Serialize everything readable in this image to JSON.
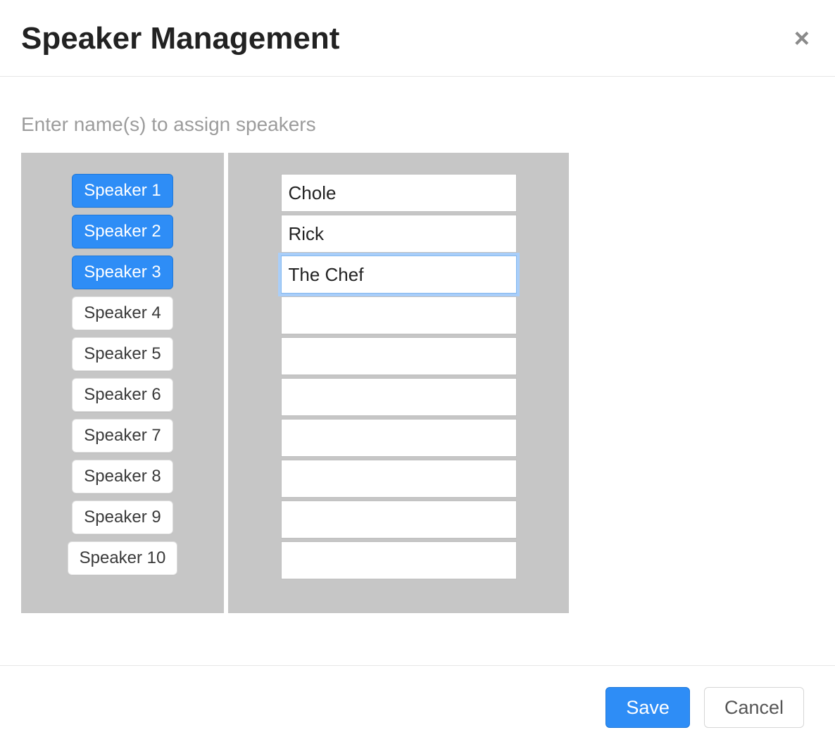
{
  "header": {
    "title": "Speaker Management",
    "close_label": "×"
  },
  "body": {
    "instruction": "Enter name(s) to assign speakers",
    "speakers": [
      {
        "label": "Speaker 1",
        "value": "Chole",
        "active": true,
        "focused": false
      },
      {
        "label": "Speaker 2",
        "value": "Rick",
        "active": true,
        "focused": false
      },
      {
        "label": "Speaker 3",
        "value": "The Chef",
        "active": true,
        "focused": true
      },
      {
        "label": "Speaker 4",
        "value": "",
        "active": false,
        "focused": false
      },
      {
        "label": "Speaker 5",
        "value": "",
        "active": false,
        "focused": false
      },
      {
        "label": "Speaker 6",
        "value": "",
        "active": false,
        "focused": false
      },
      {
        "label": "Speaker 7",
        "value": "",
        "active": false,
        "focused": false
      },
      {
        "label": "Speaker 8",
        "value": "",
        "active": false,
        "focused": false
      },
      {
        "label": "Speaker 9",
        "value": "",
        "active": false,
        "focused": false
      },
      {
        "label": "Speaker 10",
        "value": "",
        "active": false,
        "focused": false
      }
    ]
  },
  "footer": {
    "save_label": "Save",
    "cancel_label": "Cancel"
  }
}
